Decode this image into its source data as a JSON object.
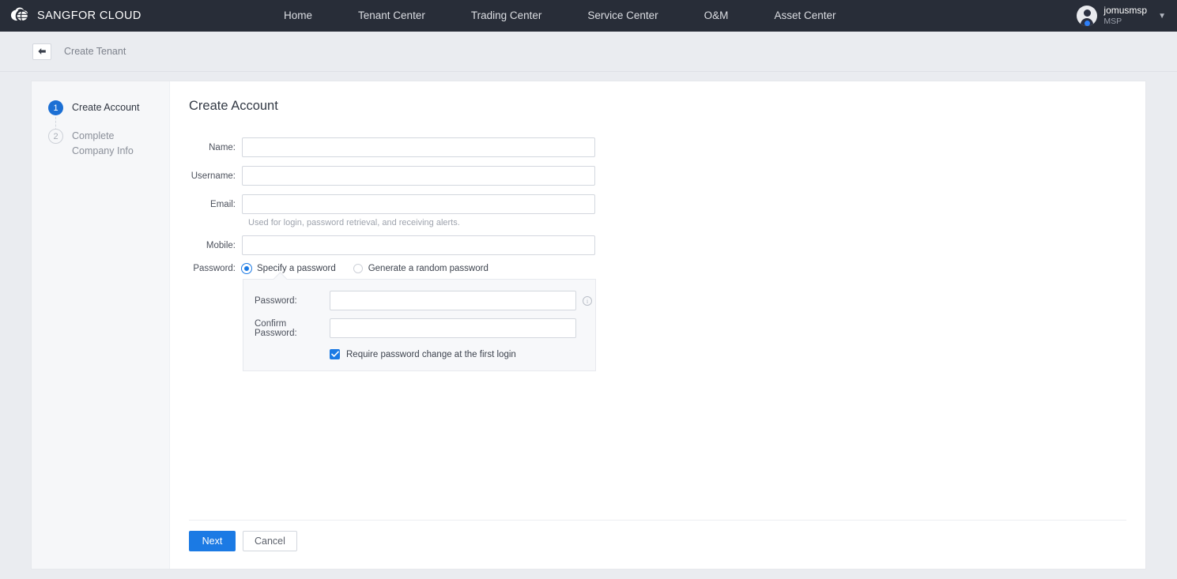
{
  "topbar": {
    "brand_name": "SANGFOR CLOUD",
    "logo_icon": "cloud-logo-icon",
    "nav_items": [
      {
        "label": "Home"
      },
      {
        "label": "Tenant Center"
      },
      {
        "label": "Trading Center"
      },
      {
        "label": "Service Center"
      },
      {
        "label": "O&M"
      },
      {
        "label": "Asset Center"
      }
    ],
    "user": {
      "name": "jomusmsp",
      "role": "MSP",
      "avatar_icon": "user-avatar-icon",
      "caret_icon": "chevron-down-icon"
    }
  },
  "breadcrumb": {
    "back_icon": "back-arrow-icon",
    "title": "Create Tenant"
  },
  "steps": [
    {
      "number": "1",
      "label": "Create Account",
      "state": "active"
    },
    {
      "number": "2",
      "label": "Complete Company Info",
      "state": "idle"
    }
  ],
  "form": {
    "title": "Create Account",
    "fields": [
      {
        "label": "Name:",
        "value": "",
        "placeholder": ""
      },
      {
        "label": "Username:",
        "value": "",
        "placeholder": ""
      },
      {
        "label": "Email:",
        "value": "",
        "placeholder": ""
      },
      {
        "label": "Mobile:",
        "value": "",
        "placeholder": ""
      }
    ],
    "email_hint": "Used for login, password retrieval, and receiving alerts.",
    "password": {
      "label": "Password:",
      "options": [
        {
          "label": "Specify a password",
          "selected": true
        },
        {
          "label": "Generate a random password",
          "selected": false
        }
      ],
      "panel": {
        "password_label": "Password:",
        "password_value": "",
        "confirm_label": "Confirm Password:",
        "confirm_value": "",
        "info_icon": "info-circle-icon",
        "require_change_label": "Require password change at the first login",
        "require_change_checked": true
      }
    }
  },
  "footer": {
    "next_label": "Next",
    "cancel_label": "Cancel"
  },
  "colors": {
    "navbar_bg": "#282d38",
    "page_bg": "#eaecf0",
    "accent_blue": "#1b7ae4",
    "step_active_blue": "#1b6fd4",
    "panel_bg": "#f7f8fa",
    "rail_bg": "#f6f7f9"
  }
}
